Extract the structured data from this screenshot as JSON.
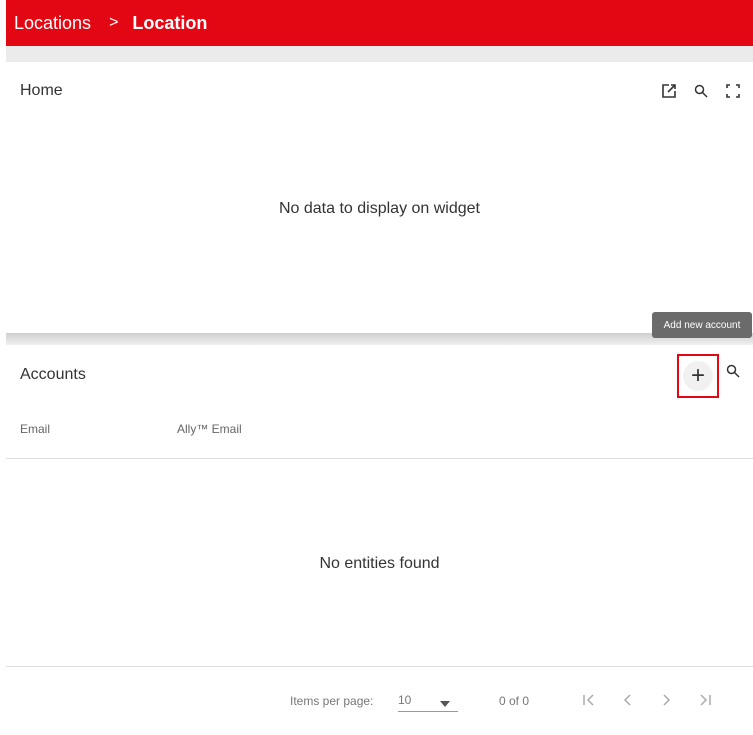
{
  "breadcrumb": {
    "parent": "Locations",
    "separator": ">",
    "current": "Location"
  },
  "home_widget": {
    "title": "Home",
    "empty_message": "No data to display on widget",
    "tools": [
      "open-in-new-icon",
      "search-icon",
      "fullscreen-icon"
    ]
  },
  "tooltip": {
    "text": "Add new account"
  },
  "accounts": {
    "title": "Accounts",
    "add_label": "+",
    "columns": [
      "Email",
      "Ally™ Email"
    ],
    "empty_message": "No entities found"
  },
  "paginator": {
    "items_per_page_label": "Items per page:",
    "items_per_page_value": "10",
    "range_label": "0 of 0"
  },
  "colors": {
    "brand": "#e30613",
    "tooltip_bg": "#6b6b6b"
  }
}
